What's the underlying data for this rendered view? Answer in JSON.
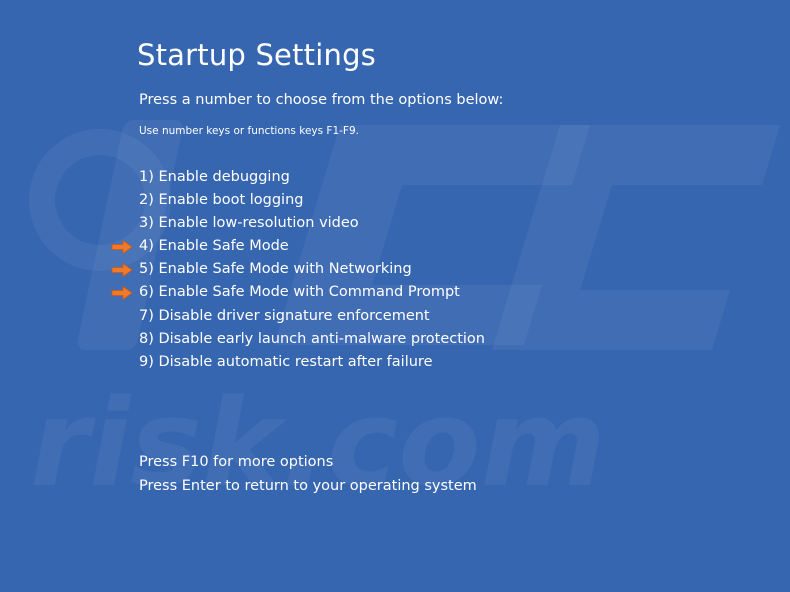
{
  "screen": {
    "title": "Startup Settings",
    "subtitle": "Press a number to choose from the options below:",
    "hint": "Use number keys or functions keys F1-F9."
  },
  "options": [
    {
      "label": "1) Enable debugging",
      "highlighted": false
    },
    {
      "label": "2) Enable boot logging",
      "highlighted": false
    },
    {
      "label": "3) Enable low-resolution video",
      "highlighted": false
    },
    {
      "label": "4) Enable Safe Mode",
      "highlighted": true
    },
    {
      "label": "5) Enable Safe Mode with Networking",
      "highlighted": true
    },
    {
      "label": "6) Enable Safe Mode with Command Prompt",
      "highlighted": true
    },
    {
      "label": "7) Disable driver signature enforcement",
      "highlighted": false
    },
    {
      "label": "8) Disable early launch anti-malware protection",
      "highlighted": false
    },
    {
      "label": "9) Disable automatic restart after failure",
      "highlighted": false
    }
  ],
  "footer": {
    "more_options": "Press F10 for more options",
    "return_os": "Press Enter to return to your operating system"
  },
  "watermark": {
    "text": "risk.com"
  },
  "colors": {
    "background": "#3766b1",
    "text": "#ffffff",
    "arrow": "#f07a2a"
  },
  "icons": {
    "pointer": "right-arrow-icon",
    "watermark_logo": "pc-logo-watermark"
  }
}
